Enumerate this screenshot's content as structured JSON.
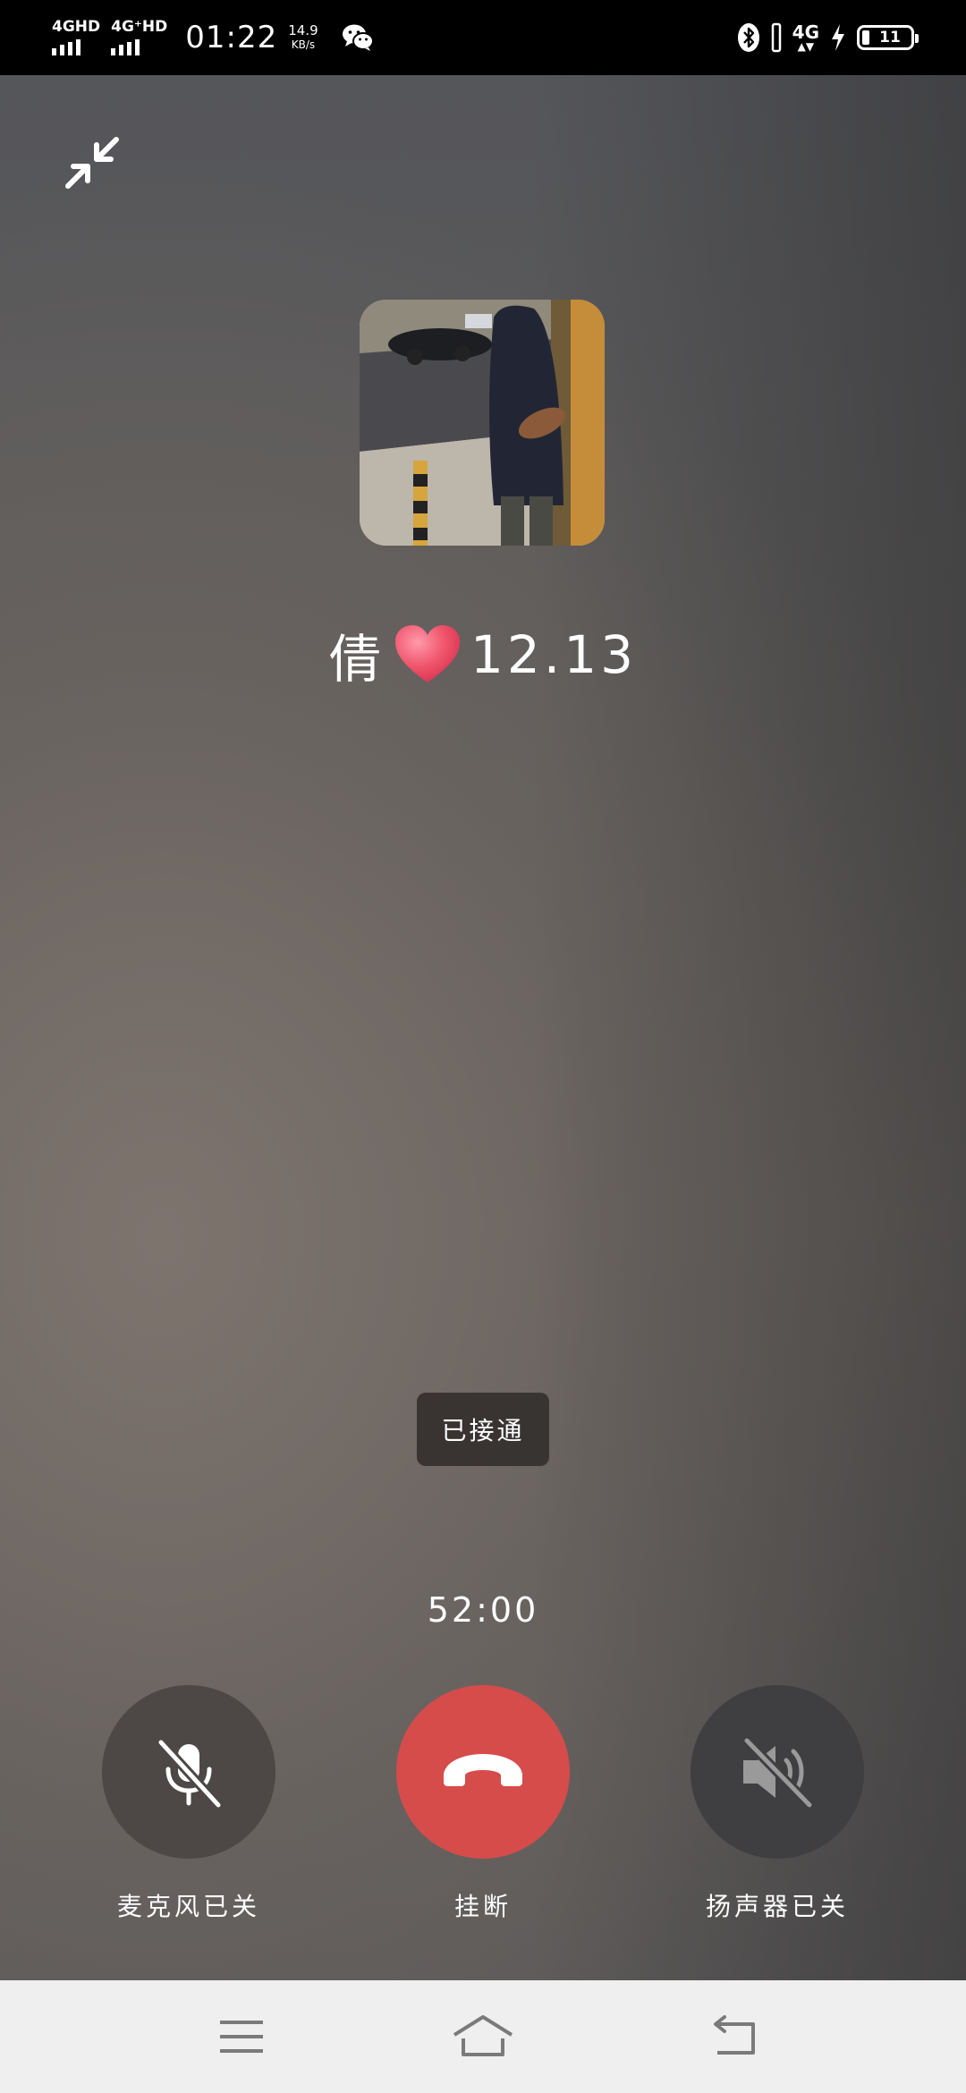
{
  "status_bar": {
    "network1": "4GHD",
    "network2": "4G⁺HD",
    "time": "01:22",
    "speed_value": "14.9",
    "speed_unit": "KB/s",
    "network3": "4G",
    "battery_text": "11",
    "icons": [
      "signal-icon",
      "wechat-icon",
      "bluetooth-icon",
      "vibrate-icon",
      "charging-icon",
      "battery-icon"
    ]
  },
  "call": {
    "caller_name_prefix": "倩",
    "caller_name_suffix": "12.13",
    "status": "已接通",
    "duration": "52:00",
    "heart_color": "#f0566e"
  },
  "controls": {
    "mic_label": "麦克风已关",
    "hangup_label": "挂断",
    "speaker_label": "扬声器已关",
    "hangup_color": "#d54c4b"
  },
  "nav": {
    "icons": [
      "menu-icon",
      "home-icon",
      "back-icon"
    ]
  }
}
